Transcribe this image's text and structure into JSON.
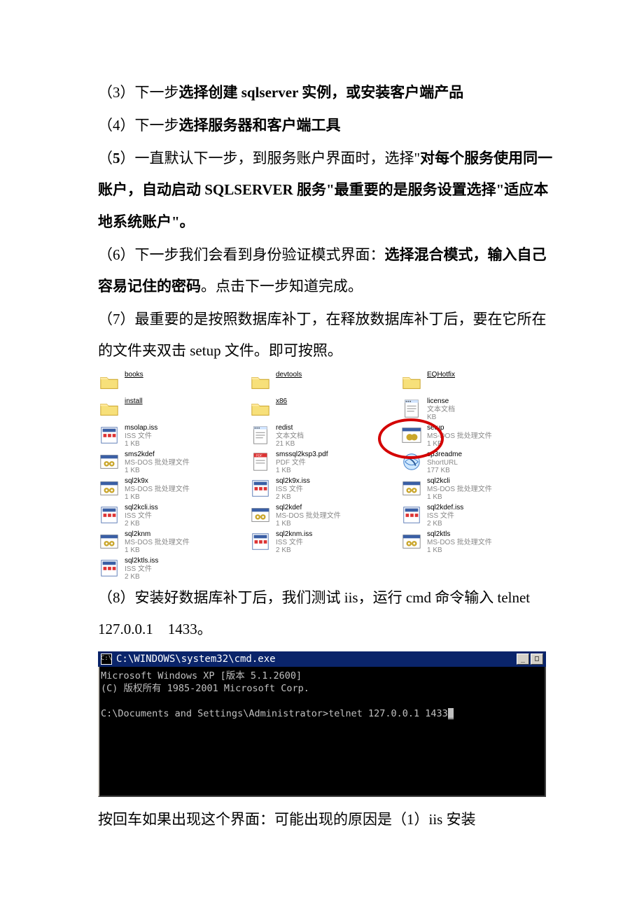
{
  "paragraphs": {
    "p3_prefix": "（3）下一步",
    "p3_bold": "选择创建 sqlserver 实例，或安装客户端产品",
    "p4_prefix": "（4）下一步",
    "p4_bold": "选择服务器和客户端工具",
    "p5_a": "（",
    "p5_b": "5",
    "p5_c": "）一直默认下一步，到服务账户界面时，选择\"",
    "p5_bold1": "对每个服务使用同一账户，自动启动 SQLSERVER 服务\"最重要的是服务设置选择\"适应本地系统账户\"。",
    "p6_prefix": "（6）下一步我们会看到身份验证模式界面：",
    "p6_bold": "选择混合模式，输入自己容易记住的密码",
    "p6_suffix": "。点击下一步知道完成。",
    "p7": "（7）最重要的是按照数据库补丁，在释放数据库补丁后，要在它所在的文件夹双击 setup 文件。即可按照。",
    "p8": "（8）安装好数据库补丁后，我们测试 iis，运行 cmd 命令输入 telnet 127.0.0.1 1433。",
    "p9": "按回车如果出现这个界面：可能出现的原因是（1）iis 安装"
  },
  "files": [
    {
      "name": "books",
      "meta1": "",
      "meta2": "",
      "type": "folder"
    },
    {
      "name": "devtools",
      "meta1": "",
      "meta2": "",
      "type": "folder"
    },
    {
      "name": "EQHotfix",
      "meta1": "",
      "meta2": "",
      "type": "folder"
    },
    {
      "name": "install",
      "meta1": "",
      "meta2": "",
      "type": "folder"
    },
    {
      "name": "x86",
      "meta1": "",
      "meta2": "",
      "type": "folder"
    },
    {
      "name": "license",
      "meta1": "文本文档",
      "meta2": "KB",
      "type": "txt"
    },
    {
      "name": "msolap.iss",
      "meta1": "ISS 文件",
      "meta2": "1 KB",
      "type": "iss"
    },
    {
      "name": "redist",
      "meta1": "文本文档",
      "meta2": "21 KB",
      "type": "txt"
    },
    {
      "name": "setup",
      "meta1": "MS-DOS 批处理文件",
      "meta2": "1 KB",
      "type": "setup"
    },
    {
      "name": "sms2kdef",
      "meta1": "MS-DOS 批处理文件",
      "meta2": "1 KB",
      "type": "bat"
    },
    {
      "name": "smssql2ksp3.pdf",
      "meta1": "PDF 文件",
      "meta2": "1 KB",
      "type": "pdf"
    },
    {
      "name": "sp3readme",
      "meta1": "ShortURL",
      "meta2": "177 KB",
      "type": "url"
    },
    {
      "name": "sql2k9x",
      "meta1": "MS-DOS 批处理文件",
      "meta2": "1 KB",
      "type": "bat"
    },
    {
      "name": "sql2k9x.iss",
      "meta1": "ISS 文件",
      "meta2": "2 KB",
      "type": "iss"
    },
    {
      "name": "sql2kcli",
      "meta1": "MS-DOS 批处理文件",
      "meta2": "1 KB",
      "type": "bat"
    },
    {
      "name": "sql2kcli.iss",
      "meta1": "ISS 文件",
      "meta2": "2 KB",
      "type": "iss"
    },
    {
      "name": "sql2kdef",
      "meta1": "MS-DOS 批处理文件",
      "meta2": "1 KB",
      "type": "bat"
    },
    {
      "name": "sql2kdef.iss",
      "meta1": "ISS 文件",
      "meta2": "2 KB",
      "type": "iss"
    },
    {
      "name": "sql2knm",
      "meta1": "MS-DOS 批处理文件",
      "meta2": "1 KB",
      "type": "bat"
    },
    {
      "name": "sql2knm.iss",
      "meta1": "ISS 文件",
      "meta2": "2 KB",
      "type": "iss"
    },
    {
      "name": "sql2ktls",
      "meta1": "MS-DOS 批处理文件",
      "meta2": "1 KB",
      "type": "bat"
    },
    {
      "name": "sql2ktls.iss",
      "meta1": "ISS 文件",
      "meta2": "2 KB",
      "type": "iss"
    }
  ],
  "cmd": {
    "title": "C:\\WINDOWS\\system32\\cmd.exe",
    "line1": "Microsoft Windows XP [版本 5.1.2600]",
    "line2": "(C) 版权所有 1985-2001 Microsoft Corp.",
    "blank": "",
    "prompt": "C:\\Documents and Settings\\Administrator>telnet 127.0.0.1 1433",
    "cursor": "_",
    "btn_min": "_",
    "btn_max": "□",
    "btn_close": "×"
  },
  "redcircle_note": "红圈标注 setup 文件"
}
